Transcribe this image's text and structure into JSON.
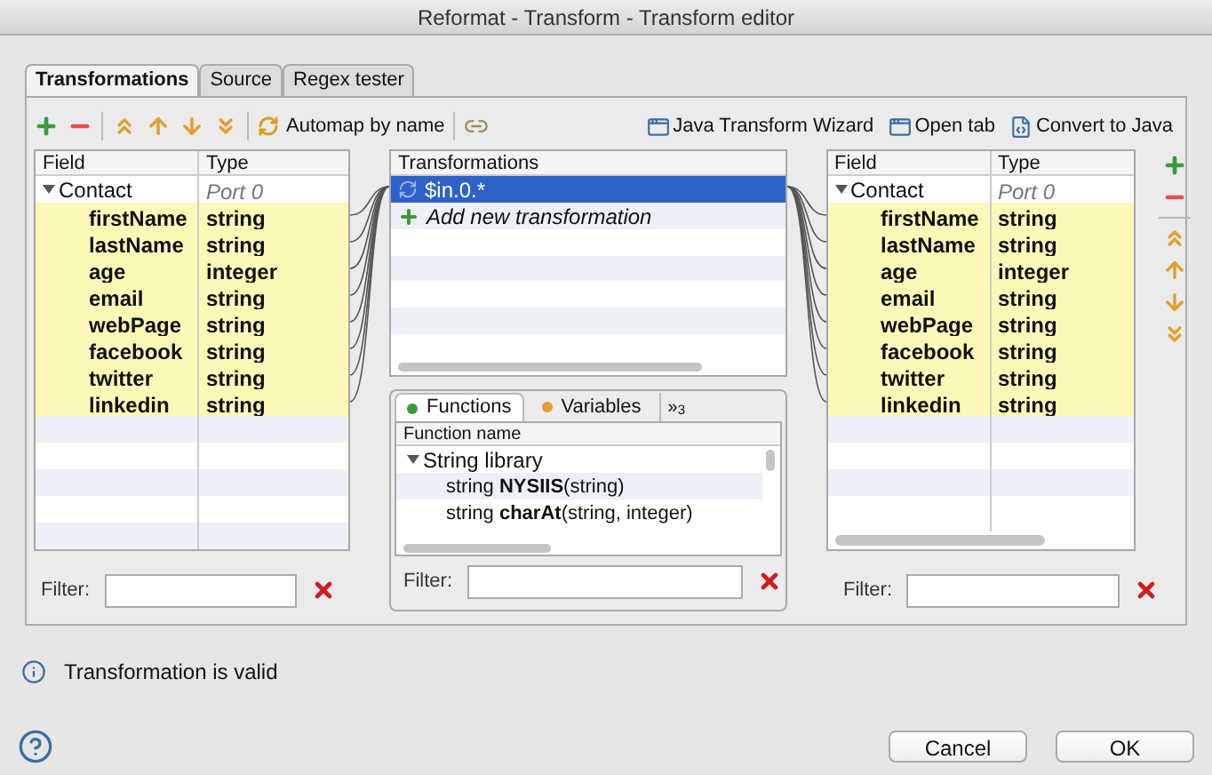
{
  "window": {
    "title": "Reformat - Transform - Transform editor"
  },
  "tabs": [
    {
      "label": "Transformations",
      "selected": true
    },
    {
      "label": "Source",
      "selected": false
    },
    {
      "label": "Regex tester",
      "selected": false
    }
  ],
  "toolbar": {
    "automap": "Automap by name",
    "actions": [
      "Java Transform Wizard",
      "Open tab",
      "Convert to Java"
    ]
  },
  "input_table": {
    "columns": [
      "Field",
      "Type"
    ],
    "record": {
      "name": "Contact",
      "type": "Port 0",
      "expanded": true
    },
    "fields": [
      {
        "name": "firstName",
        "type": "string"
      },
      {
        "name": "lastName",
        "type": "string"
      },
      {
        "name": "age",
        "type": "integer"
      },
      {
        "name": "email",
        "type": "string"
      },
      {
        "name": "webPage",
        "type": "string"
      },
      {
        "name": "facebook",
        "type": "string"
      },
      {
        "name": "twitter",
        "type": "string"
      },
      {
        "name": "linkedin",
        "type": "string"
      }
    ],
    "filter": "Filter:"
  },
  "transformations": {
    "heading": "Transformations",
    "items": [
      {
        "kind": "mapping",
        "label": "$in.0.*",
        "selected": true
      },
      {
        "kind": "add",
        "label": "Add new transformation",
        "selected": false
      }
    ]
  },
  "function_tabs": [
    {
      "label": "Functions",
      "selected": true,
      "color": "#3c9a3c"
    },
    {
      "label": "Variables",
      "selected": false,
      "color": "#e0a030"
    }
  ],
  "function_tabs_overflow": "»$_{3}$",
  "functions": {
    "column": "Function name",
    "library": {
      "name": "String library",
      "expanded": true
    },
    "items": [
      {
        "returns": "string",
        "name": "NYSIIS",
        "args": "(string)"
      },
      {
        "returns": "string",
        "name": "charAt",
        "args": "(string, integer)"
      }
    ],
    "filter": "Filter:"
  },
  "output_table": {
    "columns": [
      "Field",
      "Type"
    ],
    "record": {
      "name": "Contact",
      "type": "Port 0",
      "expanded": true
    },
    "fields": [
      {
        "name": "firstName",
        "type": "string"
      },
      {
        "name": "lastName",
        "type": "string"
      },
      {
        "name": "age",
        "type": "integer"
      },
      {
        "name": "email",
        "type": "string"
      },
      {
        "name": "webPage",
        "type": "string"
      },
      {
        "name": "facebook",
        "type": "string"
      },
      {
        "name": "twitter",
        "type": "string"
      },
      {
        "name": "linkedin",
        "type": "string"
      }
    ],
    "filter": "Filter:"
  },
  "status": "Transformation is valid",
  "buttons": [
    "Cancel",
    "OK"
  ]
}
